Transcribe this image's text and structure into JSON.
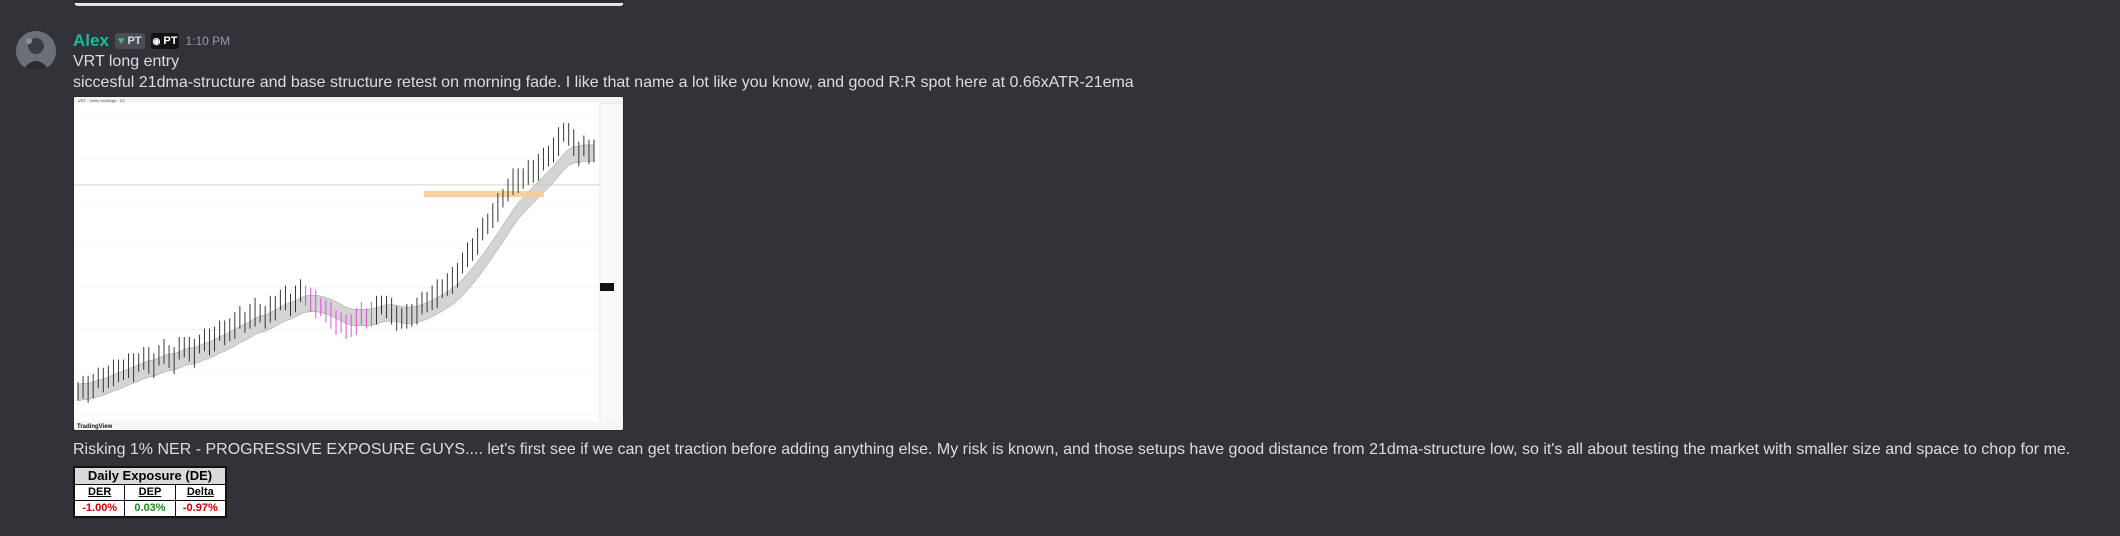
{
  "message": {
    "author": "Alex",
    "author_color": "#1abc9c",
    "role_tag_1": "PT",
    "role_tag_2": "PT",
    "timestamp": "1:10 PM",
    "lines": [
      "VRT long entry",
      "siccesful 21dma-structure and base structure retest on morning fade. I like that name a lot like you know, and good R:R spot here at 0.66xATR-21ema",
      "Risking 1% NER - PROGRESSIVE EXPOSURE GUYS.... let's first see if we can get traction before adding anything else. My risk is known, and those setups have good distance from 21dma-structure low, so it's all about testing the market with smaller size and space to chop for me."
    ]
  },
  "chart_attachment": {
    "watermark": "TradingView",
    "chart_data": {
      "type": "candlestick",
      "series": [
        {
          "name": "price",
          "values": [
            12,
            14,
            13,
            16,
            18,
            17,
            20,
            22,
            21,
            23,
            25,
            24,
            26,
            28,
            27,
            26,
            29,
            31,
            30,
            28,
            32,
            34,
            33,
            31,
            35,
            37,
            36,
            39,
            41,
            40,
            43,
            45,
            47,
            46,
            49,
            51,
            50,
            48,
            52,
            54,
            56,
            57,
            55,
            58,
            60,
            59,
            57,
            55,
            53,
            51,
            49,
            47,
            45,
            43,
            45,
            47,
            49,
            48,
            50,
            52,
            54,
            53,
            51,
            49,
            47,
            48,
            50,
            52,
            54,
            56,
            58,
            60,
            62,
            64,
            66,
            70,
            74,
            78,
            82,
            86,
            90,
            94,
            98,
            102,
            106,
            110,
            114,
            116,
            115,
            118,
            120,
            122,
            124,
            127,
            130,
            134,
            138,
            137,
            133,
            129,
            131,
            128,
            130
          ]
        }
      ],
      "highlight_band": [
        106,
        109
      ],
      "grid": true
    }
  },
  "exposure_table": {
    "title": "Daily Exposure (DE)",
    "headers": [
      "DER",
      "DEP",
      "Delta"
    ],
    "values": [
      "-1.00%",
      "0.03%",
      "-0.97%"
    ],
    "colors": [
      "#cc0000",
      "#1a8a1a",
      "#cc0000"
    ]
  }
}
